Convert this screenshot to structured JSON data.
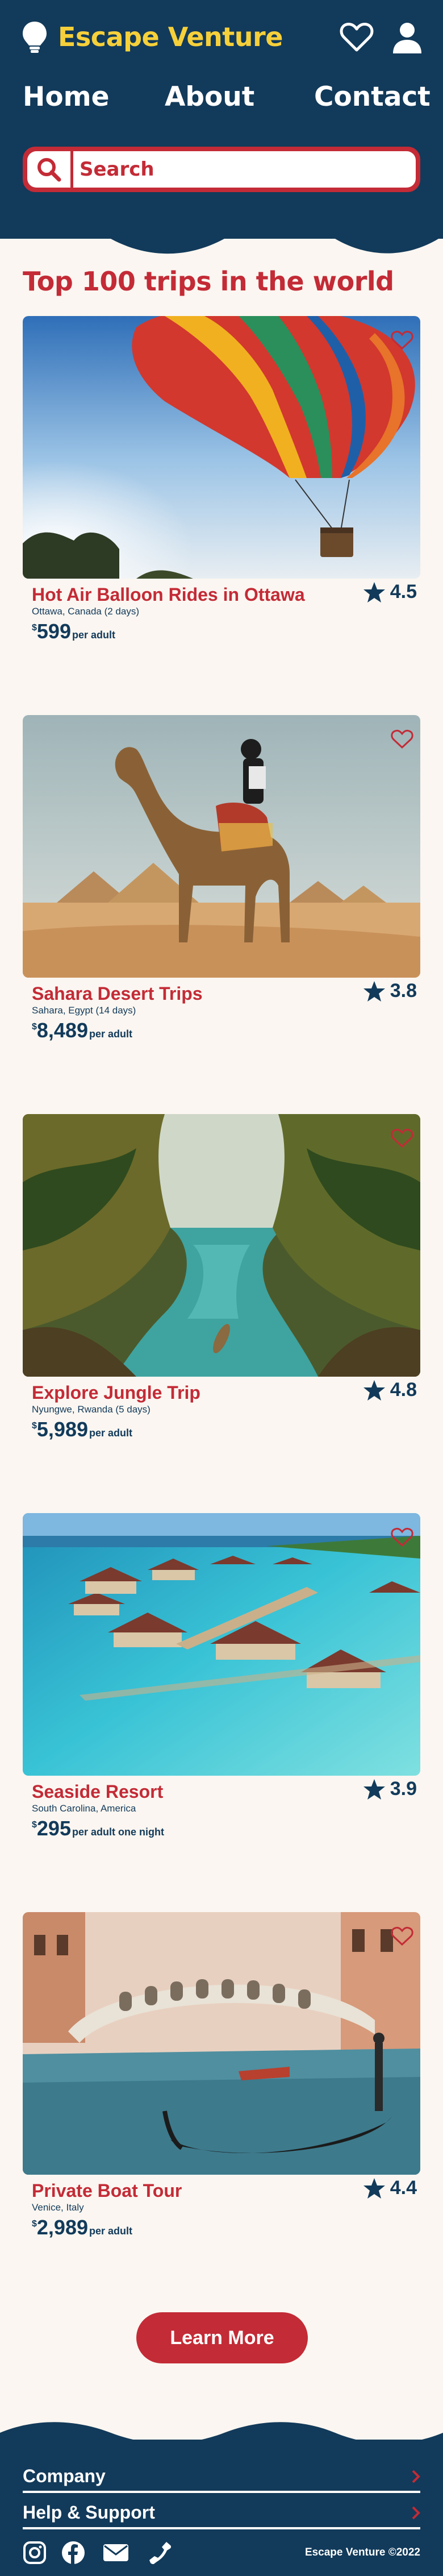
{
  "brand": {
    "name": "Escape Venture",
    "accent": "#f6d03a",
    "primary": "#123a5a",
    "secondary": "#c32b36",
    "background": "#fbf6f1"
  },
  "header": {
    "icons": [
      "lightbulb-icon",
      "heart-icon",
      "user-icon"
    ],
    "nav": [
      {
        "label": "Home"
      },
      {
        "label": "About"
      },
      {
        "label": "Contact"
      }
    ],
    "search": {
      "placeholder": "Search",
      "icon": "search-icon"
    }
  },
  "main": {
    "title": "Top 100 trips in the world",
    "trips": [
      {
        "title": "Hot Air Balloon Rides in Ottawa",
        "location": "Ottawa, Canada (2 days)",
        "currency": "$",
        "price": "599",
        "unit": "per adult",
        "rating": "4.5",
        "image": "hot-air-balloon",
        "favorite": false
      },
      {
        "title": "Sahara Desert Trips",
        "location": "Sahara, Egypt (14 days)",
        "currency": "$",
        "price": "8,489",
        "unit": "per adult",
        "rating": "3.8",
        "image": "camel-pyramids",
        "favorite": false
      },
      {
        "title": "Explore Jungle Trip",
        "location": "Nyungwe, Rwanda (5 days)",
        "currency": "$",
        "price": "5,989",
        "unit": "per adult",
        "rating": "4.8",
        "image": "jungle-river",
        "favorite": false
      },
      {
        "title": "Seaside Resort",
        "location": "South Carolina, America",
        "currency": "$",
        "price": "295",
        "unit": "per adult one night",
        "rating": "3.9",
        "image": "overwater-bungalows",
        "favorite": false
      },
      {
        "title": "Private Boat Tour",
        "location": "Venice, Italy",
        "currency": "$",
        "price": "2,989",
        "unit": "per adult",
        "rating": "4.4",
        "image": "venice-gondola",
        "favorite": false
      }
    ],
    "learn_more": "Learn More"
  },
  "footer": {
    "links": [
      {
        "label": "Company"
      },
      {
        "label": "Help & Support"
      }
    ],
    "social": [
      "instagram-icon",
      "facebook-icon",
      "mail-icon",
      "phone-icon"
    ],
    "copyright": "Escape Venture ©2022"
  }
}
